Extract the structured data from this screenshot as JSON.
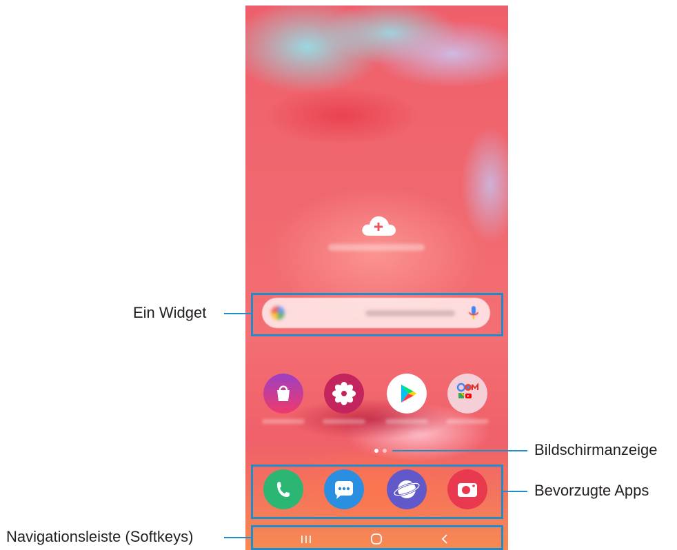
{
  "annotations": {
    "widget": "Ein Widget",
    "page_indicator": "Bildschirmanzeige",
    "favorite_apps": "Bevorzugte Apps",
    "navigation_bar": "Navigationsleiste (Softkeys)"
  },
  "home_screen": {
    "add_widget_icon": "cloud-plus-icon",
    "search_widget": {
      "google_icon": "google-logo-icon",
      "mic_icon": "microphone-icon"
    },
    "apps": [
      {
        "icon": "galaxy-store-icon",
        "color": "#e8416e"
      },
      {
        "icon": "bixby-flower-icon",
        "color": "#c0245c"
      },
      {
        "icon": "play-store-icon",
        "color": "#ffffff"
      },
      {
        "icon": "google-folder-icon",
        "color": "#f2c8d2"
      }
    ],
    "dock": [
      {
        "icon": "phone-icon",
        "color": "#2bb673"
      },
      {
        "icon": "messages-icon",
        "color": "#2a8fe0"
      },
      {
        "icon": "internet-icon",
        "color": "#6159c9"
      },
      {
        "icon": "camera-icon",
        "color": "#e8394f"
      }
    ],
    "page_dots": 2,
    "active_page": 1
  },
  "colors": {
    "callout_blue": "#1f8ec8"
  }
}
